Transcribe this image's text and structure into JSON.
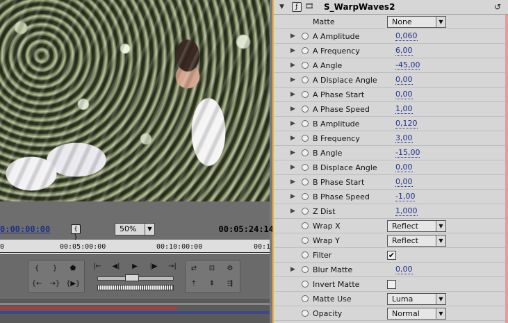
{
  "monitor": {
    "current_time": "0:00:00:00",
    "duration": "00:05:24:14",
    "zoom": "50%",
    "ruler_ticks": [
      "0",
      "00:05:00:00",
      "00:10:00:00",
      "00:1"
    ]
  },
  "effect": {
    "name": "S_WarpWaves2",
    "params": [
      {
        "label": "Matte",
        "type": "select",
        "value": "None",
        "expandable": false,
        "stopwatch": false
      },
      {
        "label": "A Amplitude",
        "type": "value",
        "value": "0,060",
        "expandable": true,
        "stopwatch": true
      },
      {
        "label": "A Frequency",
        "type": "value",
        "value": "6,00",
        "expandable": true,
        "stopwatch": true
      },
      {
        "label": "A Angle",
        "type": "value",
        "value": "-45,00",
        "expandable": true,
        "stopwatch": true
      },
      {
        "label": "A Displace Angle",
        "type": "value",
        "value": "0,00",
        "expandable": true,
        "stopwatch": true
      },
      {
        "label": "A Phase Start",
        "type": "value",
        "value": "0,00",
        "expandable": true,
        "stopwatch": true
      },
      {
        "label": "A Phase Speed",
        "type": "value",
        "value": "1,00",
        "expandable": true,
        "stopwatch": true
      },
      {
        "label": "B Amplitude",
        "type": "value",
        "value": "0,120",
        "expandable": true,
        "stopwatch": true
      },
      {
        "label": "B Frequency",
        "type": "value",
        "value": "3,00",
        "expandable": true,
        "stopwatch": true
      },
      {
        "label": "B Angle",
        "type": "value",
        "value": "-15,00",
        "expandable": true,
        "stopwatch": true
      },
      {
        "label": "B Displace Angle",
        "type": "value",
        "value": "0,00",
        "expandable": true,
        "stopwatch": true
      },
      {
        "label": "B Phase Start",
        "type": "value",
        "value": "0,00",
        "expandable": true,
        "stopwatch": true
      },
      {
        "label": "B Phase Speed",
        "type": "value",
        "value": "-1,00",
        "expandable": true,
        "stopwatch": true
      },
      {
        "label": "Z Dist",
        "type": "value",
        "value": "1,000",
        "expandable": true,
        "stopwatch": true
      },
      {
        "label": "Wrap X",
        "type": "select",
        "value": "Reflect",
        "expandable": false,
        "stopwatch": true
      },
      {
        "label": "Wrap Y",
        "type": "select",
        "value": "Reflect",
        "expandable": false,
        "stopwatch": true
      },
      {
        "label": "Filter",
        "type": "checkbox",
        "value": true,
        "expandable": false,
        "stopwatch": true
      },
      {
        "label": "Blur Matte",
        "type": "value",
        "value": "0,00",
        "expandable": true,
        "stopwatch": true
      },
      {
        "label": "Invert Matte",
        "type": "checkbox",
        "value": false,
        "expandable": false,
        "stopwatch": true
      },
      {
        "label": "Matte Use",
        "type": "select",
        "value": "Luma",
        "expandable": false,
        "stopwatch": true
      },
      {
        "label": "Opacity",
        "type": "select",
        "value": "Normal",
        "expandable": false,
        "stopwatch": true
      }
    ]
  },
  "accent_color": "#f2b43c",
  "timecode_color": "#1d2f8a"
}
